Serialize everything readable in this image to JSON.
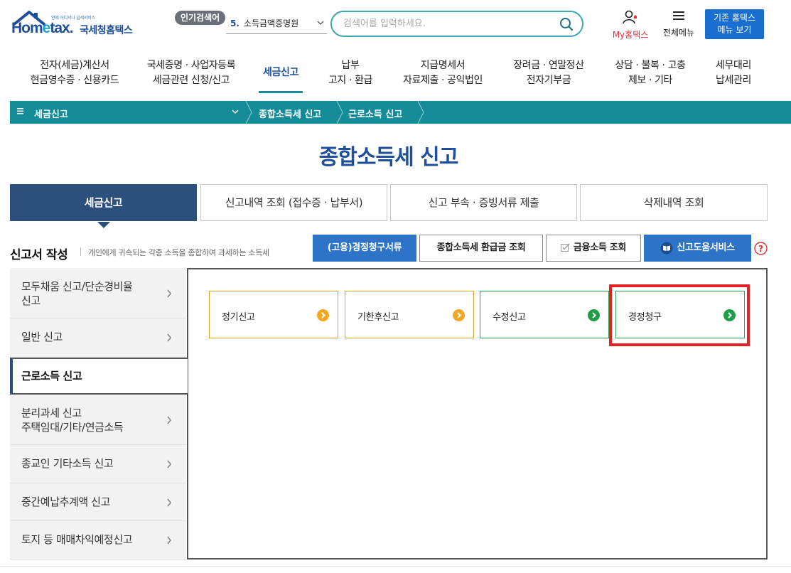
{
  "header": {
    "logo_tagline": "언제 어디서나 납세서비스",
    "logo_brand_1": "Hom",
    "logo_brand_e": "e",
    "logo_brand_2": "tax.",
    "logo_kor": "국세청홈택스",
    "popular_tag": "인기검색어",
    "popular_num": "5.",
    "popular_term": "소득금액증명원",
    "search_placeholder": "검색어를 입력하세요.",
    "my_hometax": "My홈택스",
    "all_menu": "전체메뉴",
    "old_menu_line1": "기존 홈택스",
    "old_menu_line2": "메뉴 보기"
  },
  "gnb": [
    {
      "l1": "전자(세금)계산서",
      "l2": "현금영수증 · 신용카드"
    },
    {
      "l1": "국세증명 · 사업자등록",
      "l2": "세금관련 신청/신고"
    },
    {
      "l1": "세금신고",
      "l2": ""
    },
    {
      "l1": "납부",
      "l2": "고지 · 환급"
    },
    {
      "l1": "지급명세서",
      "l2": "자료제출 · 공익법인"
    },
    {
      "l1": "장려금 · 연말정산",
      "l2": "전자기부금"
    },
    {
      "l1": "상담 · 불복 · 고충",
      "l2": "제보 · 기타"
    },
    {
      "l1": "세무대리",
      "l2": "납세관리"
    }
  ],
  "breadcrumb": {
    "root": "세금신고",
    "level2": "종합소득세 신고",
    "level3": "근로소득 신고"
  },
  "page_title": "종합소득세 신고",
  "tabs": [
    "세금신고",
    "신고내역 조회 (접수증 · 납부서)",
    "신고 부속 · 증빙서류 제출",
    "삭제내역 조회"
  ],
  "section": {
    "title": "신고서 작성",
    "desc": "개인에게 귀속되는 각종 소득을 종합하여 과세하는 소득세"
  },
  "action_buttons": {
    "employment_claim": "(고용)경정청구서류",
    "refund_query": "종합소득세 환급금 조회",
    "financial_query": "금융소득 조회",
    "help_service": "신고도움서비스"
  },
  "side_menu": [
    {
      "l1": "모두채움 신고/단순경비율",
      "l2": "신고"
    },
    {
      "l1": "일반 신고",
      "l2": ""
    },
    {
      "l1": "근로소득 신고",
      "l2": ""
    },
    {
      "l1": "분리과세 신고",
      "l2": "주택임대/기타/연금소득"
    },
    {
      "l1": "종교인 기타소득 신고",
      "l2": ""
    },
    {
      "l1": "중간예납추계액 신고",
      "l2": ""
    },
    {
      "l1": "토지 등 매매차익예정신고",
      "l2": ""
    }
  ],
  "cards": [
    "정기신고",
    "기한후신고",
    "수정신고",
    "경정청구"
  ],
  "colors": {
    "primary_navy": "#2d4f7c",
    "teal": "#158b97",
    "button_blue": "#2d74c8",
    "orange": "#f5a623",
    "green": "#1e9e48",
    "highlight_red": "#e52124"
  }
}
